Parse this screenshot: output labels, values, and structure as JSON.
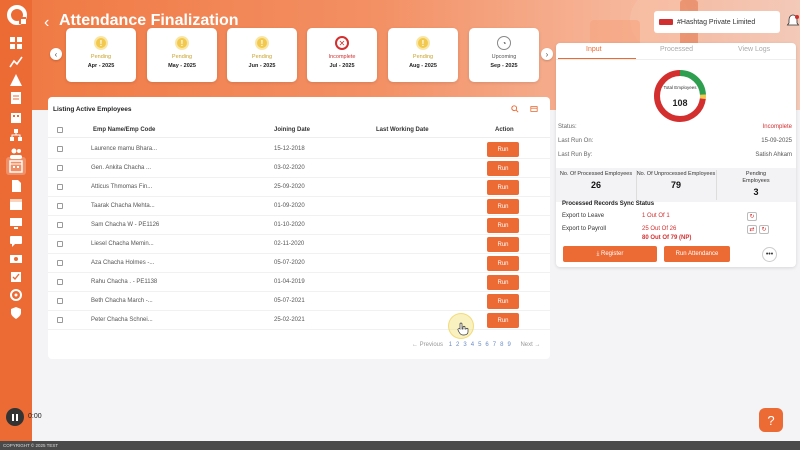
{
  "header": {
    "title": "Attendance Finalization",
    "company": "#Hashtag Private Limited"
  },
  "months": [
    {
      "status": "Pending",
      "month": "Apr - 2025",
      "kind": "pending"
    },
    {
      "status": "Pending",
      "month": "May - 2025",
      "kind": "pending"
    },
    {
      "status": "Pending",
      "month": "Jun - 2025",
      "kind": "pending"
    },
    {
      "status": "Incomplete",
      "month": "Jul - 2025",
      "kind": "incomplete"
    },
    {
      "status": "Pending",
      "month": "Aug - 2025",
      "kind": "pending"
    },
    {
      "status": "Upcoming",
      "month": "Sep - 2025",
      "kind": "upcoming"
    }
  ],
  "listing": {
    "title": "Listing Active Employees",
    "columns": {
      "emp": "Emp Name/Emp Code",
      "joining": "Joining Date",
      "last": "Last Working Date",
      "action": "Action"
    },
    "rows": [
      {
        "name": "Laurence mamu Bhara...",
        "joining": "15-12-2018",
        "last": "",
        "action": "Run"
      },
      {
        "name": "Gen. Ankita Chacha ...",
        "joining": "03-02-2020",
        "last": "",
        "action": "Run"
      },
      {
        "name": "Atticus Thmomas Fin...",
        "joining": "25-09-2020",
        "last": "",
        "action": "Run"
      },
      {
        "name": "Taarak Chacha Mehta...",
        "joining": "01-09-2020",
        "last": "",
        "action": "Run"
      },
      {
        "name": "Sam Chacha W - PE1126",
        "joining": "01-10-2020",
        "last": "",
        "action": "Run"
      },
      {
        "name": "Liesel Chacha Memin...",
        "joining": "02-11-2020",
        "last": "",
        "action": "Run"
      },
      {
        "name": "Aza Chacha Holmes -...",
        "joining": "05-07-2020",
        "last": "",
        "action": "Run"
      },
      {
        "name": "Rahu Chacha . - PE1138",
        "joining": "01-04-2019",
        "last": "",
        "action": "Run"
      },
      {
        "name": "Beth Chacha March -...",
        "joining": "05-07-2021",
        "last": "",
        "action": "Run"
      },
      {
        "name": "Peter Chacha Schnei...",
        "joining": "25-02-2021",
        "last": "",
        "action": "Run"
      }
    ],
    "pager": {
      "prev": "← Previous",
      "pages": [
        "1",
        "2",
        "3",
        "4",
        "5",
        "6",
        "7",
        "8",
        "9"
      ],
      "current": "1",
      "next": "Next →"
    }
  },
  "panel": {
    "tabs": [
      "Input",
      "Processed",
      "View Logs"
    ],
    "active_tab": "Input",
    "donut": {
      "label": "Total Employees",
      "value": "108",
      "processed": 26,
      "unprocessed": 79,
      "pending": 3,
      "colors": {
        "processed": "#2e9e4f",
        "unprocessed": "#d32f2f",
        "pending": "#f2c94c"
      }
    },
    "status_label": "Status:",
    "status_value": "Incomplete",
    "last_run_on_label": "Last Run On:",
    "last_run_on_value": "15-09-2025",
    "last_run_by_label": "Last Run By:",
    "last_run_by_value": "Satish Ahkam",
    "stats": [
      {
        "label": "No. Of Processed Employees",
        "value": "26"
      },
      {
        "label": "No. Of Unprocessed Employees",
        "value": "79"
      },
      {
        "label": "Pending Employees",
        "value": "3"
      }
    ],
    "sync": {
      "title": "Processed Records Sync Status",
      "leave_label": "Export to Leave",
      "leave_value": "1 Out Of 1",
      "payroll_label": "Export to Payroll",
      "payroll_value_1": "25 Out Of 26",
      "payroll_value_2": "80 Out Of 79 (NP)"
    },
    "register_label": "Register",
    "run_attendance_label": "Run Attendance",
    "more_label": "•••"
  },
  "footer": {
    "copyright": "COPYRIGHT © 2025 TEST"
  },
  "video": {
    "time": "0:00"
  },
  "help": {
    "label": "?"
  },
  "accent": "#ec6b35"
}
